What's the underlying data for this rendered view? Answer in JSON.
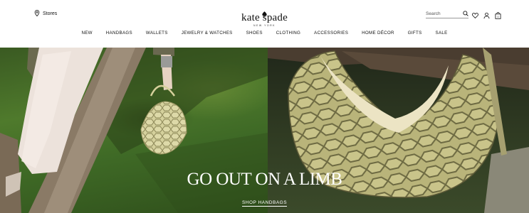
{
  "header": {
    "stores_label": "Stores",
    "brand": "kate spade",
    "brand_sub": "NEW YORK",
    "search_placeholder": "Search"
  },
  "nav": {
    "items": [
      "NEW",
      "HANDBAGS",
      "WALLETS",
      "JEWELRY & WATCHES",
      "SHOES",
      "CLOTHING",
      "ACCESSORIES",
      "HOME DÉCOR",
      "GIFTS",
      "SALE"
    ]
  },
  "hero": {
    "headline": "GO OUT ON A LIMB",
    "cta_label": "SHOP HANDBAGS"
  },
  "icons": [
    "location-pin-icon",
    "spade-icon",
    "search-icon",
    "heart-icon",
    "user-icon",
    "shopping-bag-icon"
  ],
  "colors": {
    "text": "#111111",
    "hero_text": "#ffffff",
    "grass": "#4f7a2c",
    "bag": "#c9c48a"
  }
}
